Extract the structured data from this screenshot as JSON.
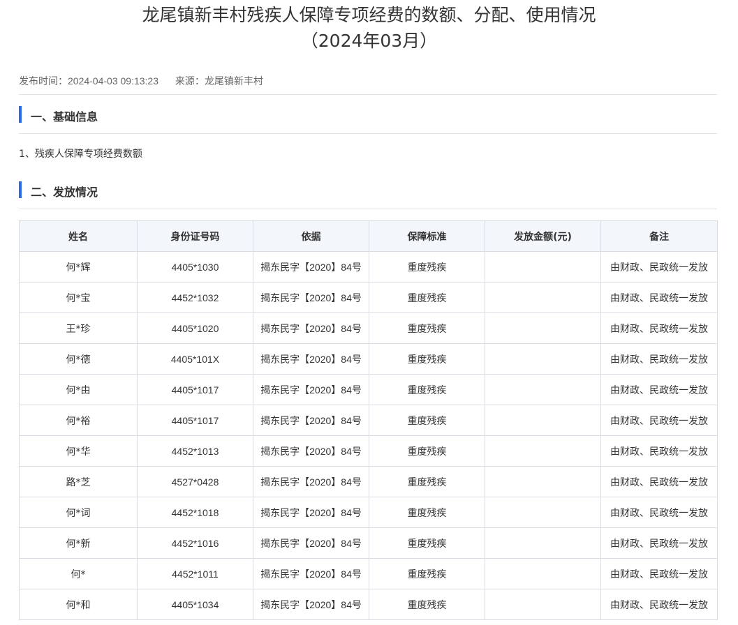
{
  "article": {
    "title_line1": "龙尾镇新丰村残疾人保障专项经费的数额、分配、使用情况",
    "title_line2": "（2024年03月）",
    "publish_time": "发布时间：2024-04-03 09:13:23",
    "source": "来源：龙尾镇新丰村"
  },
  "sections": [
    {
      "heading": "一、基础信息"
    },
    {
      "heading": "二、发放情况"
    }
  ],
  "basic_info": {
    "item1": "1、残疾人保障专项经费数额"
  },
  "table": {
    "headers": [
      "姓名",
      "身份证号码",
      "依据",
      "保障标准",
      "发放金额(元)",
      "备注"
    ],
    "rows": [
      [
        "何*辉",
        "4405*1030",
        "揭东民字【2020】84号",
        "重度残疾",
        "",
        "由财政、民政统一发放"
      ],
      [
        "何*宝",
        "4452*1032",
        "揭东民字【2020】84号",
        "重度残疾",
        "",
        "由财政、民政统一发放"
      ],
      [
        "王*珍",
        "4405*1020",
        "揭东民字【2020】84号",
        "重度残疾",
        "",
        "由财政、民政统一发放"
      ],
      [
        "何*德",
        "4405*101X",
        "揭东民字【2020】84号",
        "重度残疾",
        "",
        "由财政、民政统一发放"
      ],
      [
        "何*由",
        "4405*1017",
        "揭东民字【2020】84号",
        "重度残疾",
        "",
        "由财政、民政统一发放"
      ],
      [
        "何*裕",
        "4405*1017",
        "揭东民字【2020】84号",
        "重度残疾",
        "",
        "由财政、民政统一发放"
      ],
      [
        "何*华",
        "4452*1013",
        "揭东民字【2020】84号",
        "重度残疾",
        "",
        "由财政、民政统一发放"
      ],
      [
        "路*芝",
        "4527*0428",
        "揭东民字【2020】84号",
        "重度残疾",
        "",
        "由财政、民政统一发放"
      ],
      [
        "何*词",
        "4452*1018",
        "揭东民字【2020】84号",
        "重度残疾",
        "",
        "由财政、民政统一发放"
      ],
      [
        "何*新",
        "4452*1016",
        "揭东民字【2020】84号",
        "重度残疾",
        "",
        "由财政、民政统一发放"
      ],
      [
        "何*",
        "4452*1011",
        "揭东民字【2020】84号",
        "重度残疾",
        "",
        "由财政、民政统一发放"
      ],
      [
        "何*和",
        "4405*1034",
        "揭东民字【2020】84号",
        "重度残疾",
        "",
        "由财政、民政统一发放"
      ]
    ]
  },
  "colors": {
    "accent": "#2b6ce0",
    "header_bg": "#f3f6fa",
    "border": "#d9dde3"
  }
}
